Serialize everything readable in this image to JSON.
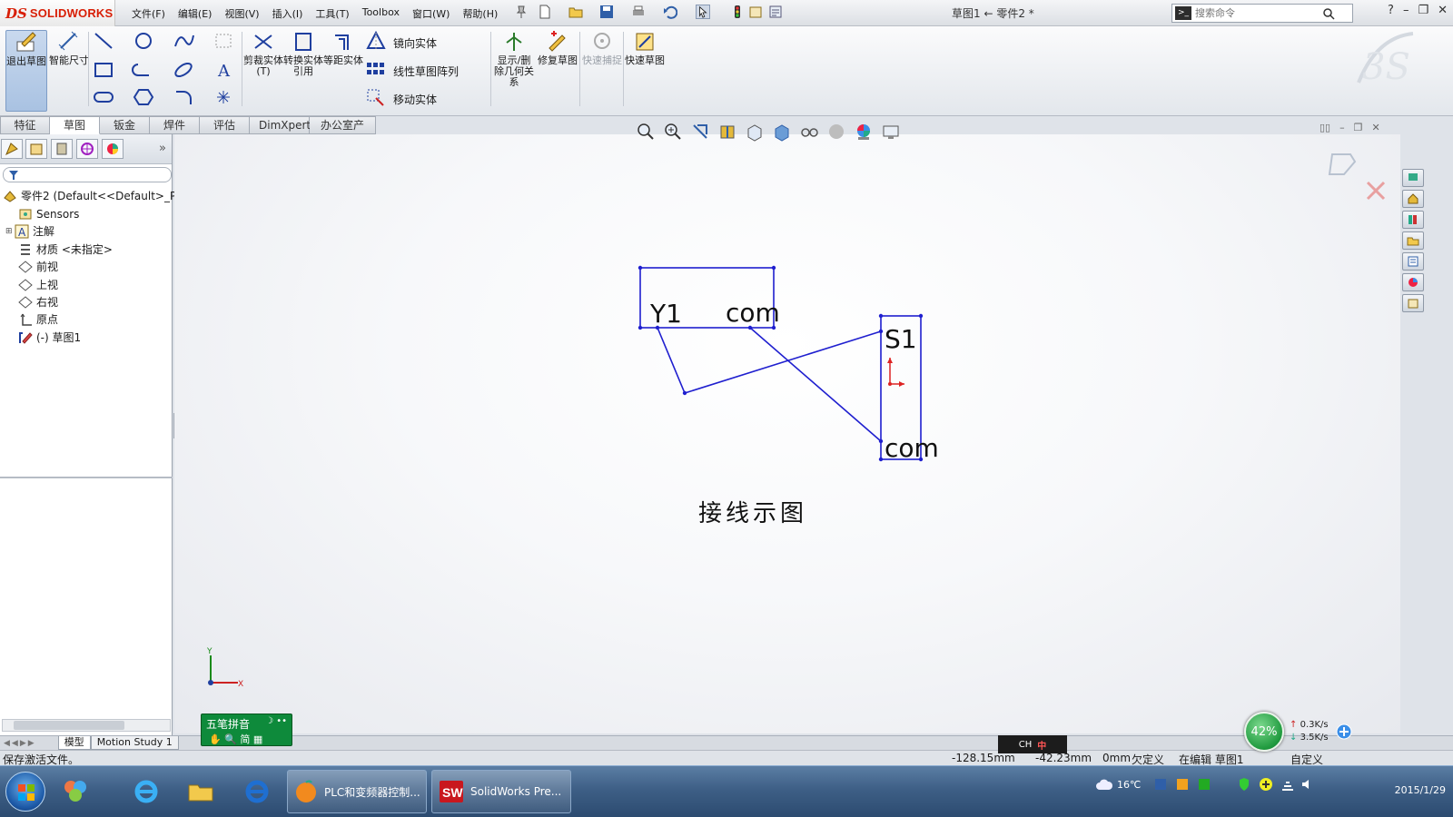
{
  "app": {
    "logo_ds": "DS",
    "logo_name": "SOLIDWORKS",
    "doc_title": "草图1 ← 零件2 *"
  },
  "menu": [
    "文件(F)",
    "编辑(E)",
    "视图(V)",
    "插入(I)",
    "工具(T)",
    "Toolbox",
    "窗口(W)",
    "帮助(H)"
  ],
  "search": {
    "placeholder": "搜索命令"
  },
  "ribbon": {
    "exit_sketch": "退出草图",
    "smart_dim": "智能尺寸",
    "trim": "剪裁实体(T)",
    "convert": "转换实体引用",
    "offset": "等距实体",
    "mirror": "镜向实体",
    "linear_pattern": "线性草图阵列",
    "move": "移动实体",
    "display_relations": "显示/删除几何关系",
    "repair": "修复草图",
    "quick_snaps": "快速捕捉",
    "rapid_sketch": "快速草图"
  },
  "cm_tabs": [
    "特征",
    "草图",
    "钣金",
    "焊件",
    "评估",
    "DimXpert",
    "办公室产品"
  ],
  "cm_active_tab": "草图",
  "tree": {
    "root": "零件2  (Default<<Default>_Ph",
    "items": [
      "Sensors",
      "注解",
      "材质 <未指定>",
      "前视",
      "上视",
      "右视",
      "原点",
      "(-) 草图1"
    ]
  },
  "sketch": {
    "label_y1": "Y1",
    "label_com_top": "com",
    "label_s1": "S1",
    "label_com_bottom": "com",
    "caption": "接线示图",
    "triad_y": "Y",
    "triad_x": "X"
  },
  "model_tabs": [
    "模型",
    "Motion Study 1"
  ],
  "ime": {
    "name": "五笔拼音",
    "mode": "简"
  },
  "status": {
    "message": "保存激活文件。",
    "x": "-128.15mm",
    "y": "-42.23mm",
    "z": "0mm",
    "define": "欠定义",
    "editing": "在编辑 草图1",
    "custom": "自定义"
  },
  "network": {
    "percent": "42%",
    "up": "0.3K/s",
    "down": "3.5K/s"
  },
  "taskbar": {
    "task1": "PLC和变频器控制...",
    "task2": "SolidWorks Pre...",
    "weather": "16℃",
    "lang": "CH",
    "date": "2015/1/29"
  },
  "colors": {
    "sketch_line": "#1f1fcf",
    "accent_red": "#d81e05",
    "taskbar": "#3e5f86"
  }
}
